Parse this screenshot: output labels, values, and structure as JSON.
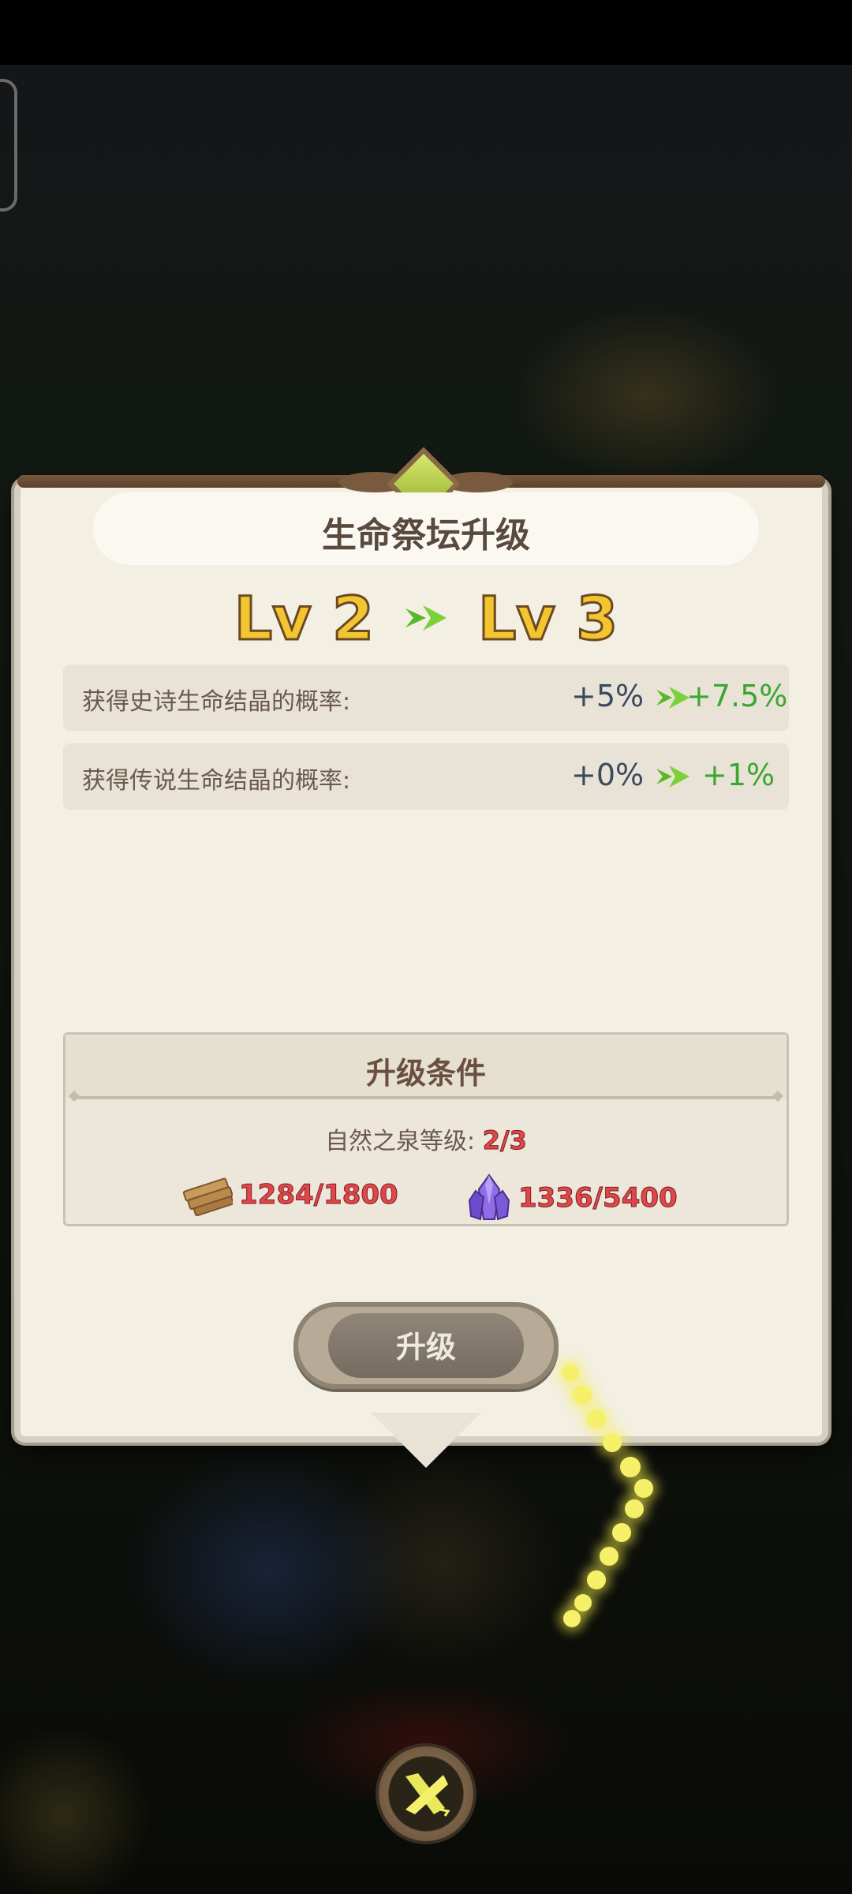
{
  "dialog": {
    "title": "生命祭坛升级",
    "level_from": "Lv 2",
    "level_to": "Lv 3"
  },
  "stats": [
    {
      "label": "获得史诗生命结晶的概率:",
      "old_value": "+5%",
      "new_value": "+7.5%"
    },
    {
      "label": "获得传说生命结晶的概率:",
      "old_value": "+0%",
      "new_value": "+1%"
    }
  ],
  "requirements": {
    "title": "升级条件",
    "building_label": "自然之泉等级:",
    "building_progress": "2/3",
    "resources": [
      {
        "icon": "wood-planks-icon",
        "value": "1284/1800"
      },
      {
        "icon": "purple-crystal-icon",
        "value": "1336/5400"
      }
    ]
  },
  "buttons": {
    "upgrade_label": "升级"
  },
  "colors": {
    "panel_bg": "#f3efe3",
    "level_gold": "#f2c531",
    "increase_green": "#3ea531",
    "insufficient_red": "#e0464a",
    "button_gray": "#8f8678"
  }
}
